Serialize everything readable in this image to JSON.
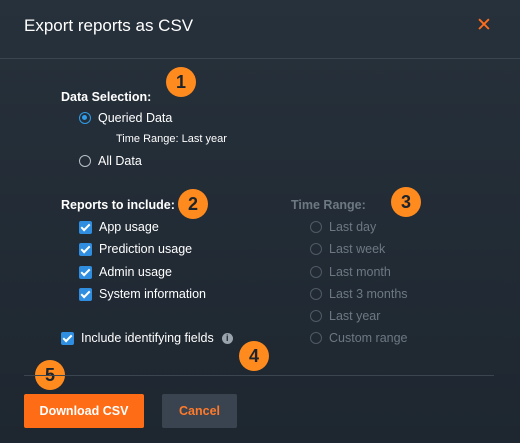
{
  "dialog": {
    "title": "Export reports as CSV",
    "close_icon": "close-icon"
  },
  "callouts": [
    "1",
    "2",
    "3",
    "4",
    "5"
  ],
  "data_selection": {
    "label": "Data Selection:",
    "options": [
      {
        "label": "Queried Data",
        "selected": true
      },
      {
        "label": "All Data",
        "selected": false
      }
    ],
    "time_range_note": "Time Range: Last year"
  },
  "reports": {
    "label": "Reports to include:",
    "items": [
      {
        "label": "App usage",
        "checked": true
      },
      {
        "label": "Prediction usage",
        "checked": true
      },
      {
        "label": "Admin usage",
        "checked": true
      },
      {
        "label": "System information",
        "checked": true
      }
    ]
  },
  "time_range": {
    "label": "Time Range:",
    "options": [
      {
        "label": "Last day",
        "selected": false
      },
      {
        "label": "Last week",
        "selected": false
      },
      {
        "label": "Last month",
        "selected": false
      },
      {
        "label": "Last 3 months",
        "selected": false
      },
      {
        "label": "Last year",
        "selected": true
      },
      {
        "label": "Custom range",
        "selected": false
      }
    ],
    "disabled": true
  },
  "identifying": {
    "label": "Include identifying fields",
    "checked": true,
    "info_icon": "info-icon"
  },
  "buttons": {
    "download": "Download CSV",
    "cancel": "Cancel"
  },
  "colors": {
    "accent": "#ff6c16",
    "badge": "#ff8a1e",
    "check": "#2f8ee0",
    "background": "#27313b"
  }
}
